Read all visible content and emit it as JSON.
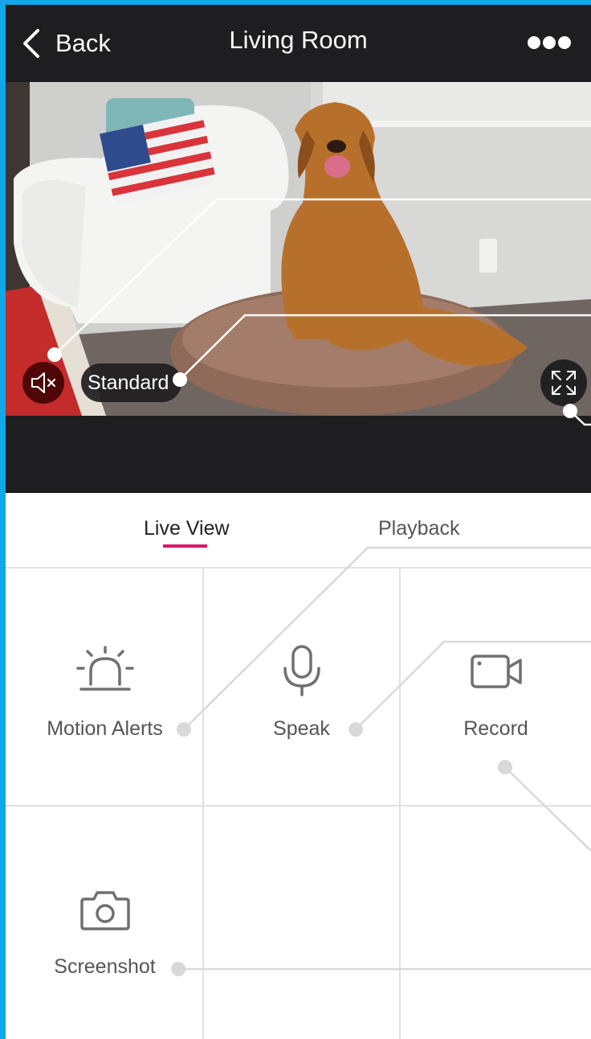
{
  "header": {
    "back_label": "Back",
    "title": "Living Room"
  },
  "video": {
    "quality_label": "Standard",
    "audio_state": "muted"
  },
  "tabs": [
    {
      "label": "Live View",
      "active": true
    },
    {
      "label": "Playback",
      "active": false
    }
  ],
  "actions": [
    {
      "label": "Motion Alerts",
      "icon": "siren-icon"
    },
    {
      "label": "Speak",
      "icon": "microphone-icon"
    },
    {
      "label": "Record",
      "icon": "video-camera-icon"
    },
    {
      "label": "Screenshot",
      "icon": "camera-icon"
    }
  ],
  "colors": {
    "frame": "#12a7e6",
    "header_bg": "#1e1d20",
    "active_tab_underline": "#e0156a",
    "icon_gray": "#707070"
  }
}
